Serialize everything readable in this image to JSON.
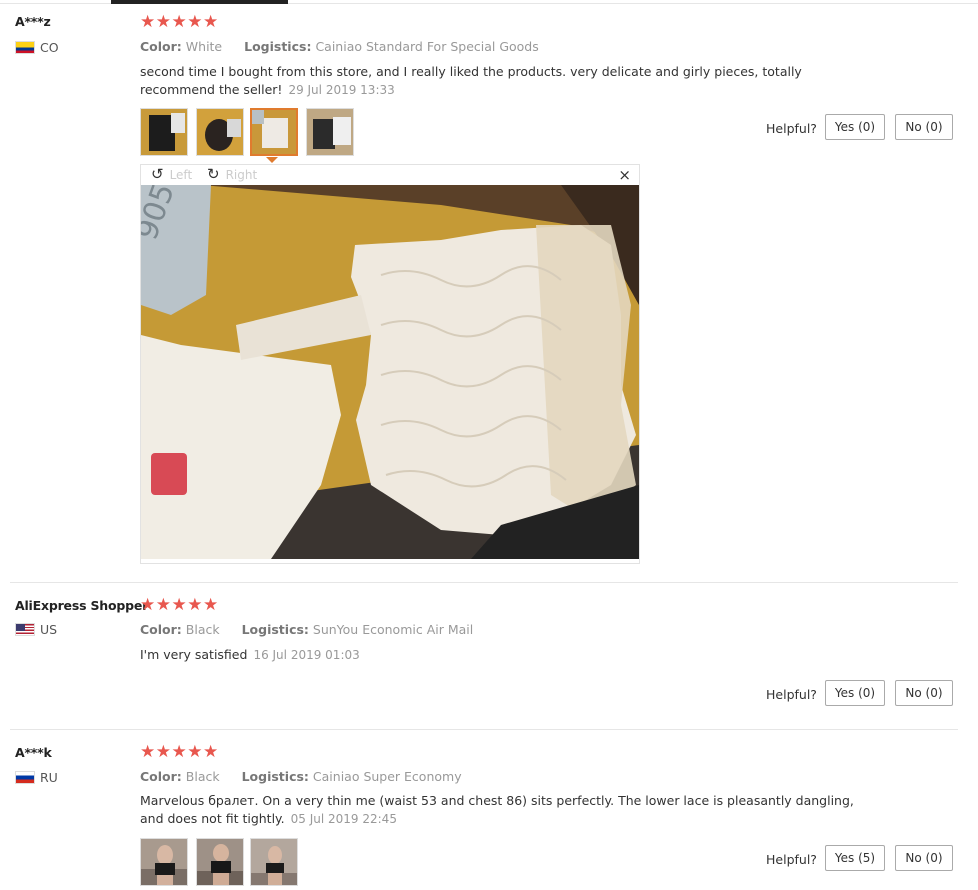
{
  "reviews": [
    {
      "buyer": "A***z",
      "country": "CO",
      "stars": "★★★★★",
      "color_key": "Color:",
      "color_val": "White",
      "logistics_key": "Logistics:",
      "logistics_val": "Cainiao Standard For Special Goods",
      "text": "second time I bought from this store, and I really liked the products. very delicate and girly pieces, totally recommend the seller!",
      "date": "29 Jul 2019 13:33",
      "helpful": "Helpful?",
      "yes": "Yes (0)",
      "no": "No (0)"
    },
    {
      "buyer": "AliExpress Shopper",
      "country": "US",
      "stars": "★★★★★",
      "color_key": "Color:",
      "color_val": "Black",
      "logistics_key": "Logistics:",
      "logistics_val": "SunYou Economic Air Mail",
      "text": "I'm very satisfied",
      "date": "16 Jul 2019 01:03",
      "helpful": "Helpful?",
      "yes": "Yes (0)",
      "no": "No (0)"
    },
    {
      "buyer": "A***k",
      "country": "RU",
      "stars": "★★★★★",
      "color_key": "Color:",
      "color_val": "Black",
      "logistics_key": "Logistics:",
      "logistics_val": "Cainiao Super Economy",
      "text": "Marvelous бралет. On a very thin me (waist 53 and chest 86) sits perfectly. The lower lace is pleasantly dangling, and does not fit tightly.",
      "date": "05 Jul 2019 22:45",
      "helpful": "Helpful?",
      "yes": "Yes (5)",
      "no": "No (0)"
    }
  ],
  "viewer": {
    "left_label": "Left",
    "right_label": "Right",
    "rotate_left_icon": "↺",
    "rotate_right_icon": "↻",
    "close_icon": "×"
  },
  "colors": {
    "star": "#e8574e",
    "selected_thumb": "#e07b2e"
  }
}
